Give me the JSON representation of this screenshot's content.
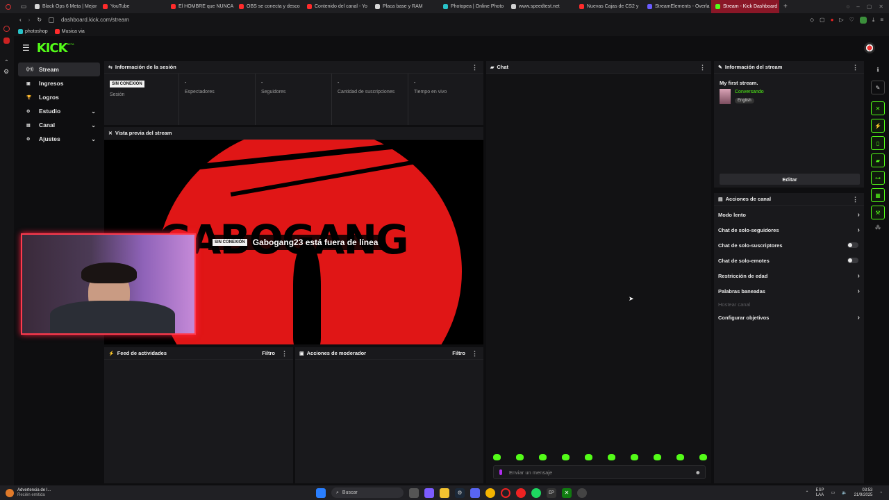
{
  "browser": {
    "tabs": [
      {
        "title": "Black Ops 6 Meta | Mejor",
        "color": "#d8d8d8"
      },
      {
        "title": "YouTube",
        "color": "#ff2b2b"
      },
      {
        "title": "El HOMBRE que NUNCA",
        "color": "#ff2b2b"
      },
      {
        "title": "OBS se conecta y desco",
        "color": "#ff2b2b"
      },
      {
        "title": "Contenido del canal - Yo",
        "color": "#ff2b2b"
      },
      {
        "title": "Placa base y RAM",
        "color": "#d8d8d8"
      },
      {
        "title": "Photopea | Online Photo",
        "color": "#28c2c8"
      },
      {
        "title": "www.speedtest.net",
        "color": "#cfcfcf"
      },
      {
        "title": "Nuevas Cajas de CS2 y",
        "color": "#ff2b2b"
      },
      {
        "title": "StreamElements - Overla",
        "color": "#6a5cff"
      },
      {
        "title": "Stream - Kick Dashboard",
        "color": "#53fc18",
        "active": true
      }
    ],
    "new_tab": "+",
    "url": "dashboard.kick.com/stream",
    "bookmarks": [
      {
        "label": "photoshop",
        "color": "#28c2c8"
      },
      {
        "label": "Musica via",
        "color": "#ff2b2b"
      }
    ]
  },
  "app": {
    "logo": "KICK",
    "logo_beta": "BETA",
    "accent": "#53fc18",
    "sidebar": {
      "items": [
        {
          "label": "Stream",
          "icon": "broadcast-icon",
          "glyph": "((•))",
          "active": true
        },
        {
          "label": "Ingresos",
          "icon": "wallet-icon",
          "glyph": "▣"
        },
        {
          "label": "Logros",
          "icon": "trophy-icon",
          "glyph": "🏆"
        },
        {
          "label": "Estudio",
          "icon": "studio-icon",
          "glyph": "⚙",
          "chevron": true
        },
        {
          "label": "Canal",
          "icon": "channel-icon",
          "glyph": "▤",
          "chevron": true
        },
        {
          "label": "Ajustes",
          "icon": "settings-icon",
          "glyph": "⚙",
          "chevron": true
        }
      ]
    },
    "session": {
      "title": "Información de la sesión",
      "status_badge": "SIN CONEXIÓN",
      "session_label": "Sesión",
      "stats": [
        {
          "value": "-",
          "label": "Espectadores"
        },
        {
          "value": "-",
          "label": "Seguidores"
        },
        {
          "value": "-",
          "label": "Cantidad de suscripciones"
        },
        {
          "value": "-",
          "label": "Tiempo en vivo"
        }
      ]
    },
    "preview": {
      "title": "Vista previa del stream",
      "offline_badge": "SIN CONEXIÓN",
      "offline_text": "Gabogang23 está fuera de línea",
      "banner_text": "GABOGANG"
    },
    "feed": {
      "title": "Feed de actividades",
      "filter": "Filtro"
    },
    "mod": {
      "title": "Acciones de moderador",
      "filter": "Filtro"
    },
    "chat": {
      "title": "Chat",
      "placeholder": "Enviar un mensaje",
      "emote_count": 10
    },
    "stream_info": {
      "title": "Información del stream",
      "stream_title": "My first stream.",
      "category": "Conversando",
      "language": "English",
      "edit_button": "Editar"
    },
    "channel_actions": {
      "title": "Acciones de canal",
      "items": [
        {
          "label": "Modo lento",
          "type": "arrow"
        },
        {
          "label": "Chat de solo-seguidores",
          "type": "arrow"
        },
        {
          "label": "Chat de solo-suscriptores",
          "type": "toggle"
        },
        {
          "label": "Chat de solo-emotes",
          "type": "toggle"
        },
        {
          "label": "Restricción de edad",
          "type": "arrow"
        },
        {
          "label": "Palabras baneadas",
          "type": "arrow"
        },
        {
          "label": "Hostear canal",
          "type": "disabled"
        },
        {
          "label": "Configurar objetivos",
          "type": "arrow"
        }
      ]
    }
  },
  "taskbar": {
    "notification_title": "Advertencia de I...",
    "notification_sub": "Recién emitida",
    "search_label": "Buscar",
    "lang_top": "ESP",
    "lang_bottom": "LAA",
    "time": "03:53",
    "date": "21/9/2025"
  }
}
